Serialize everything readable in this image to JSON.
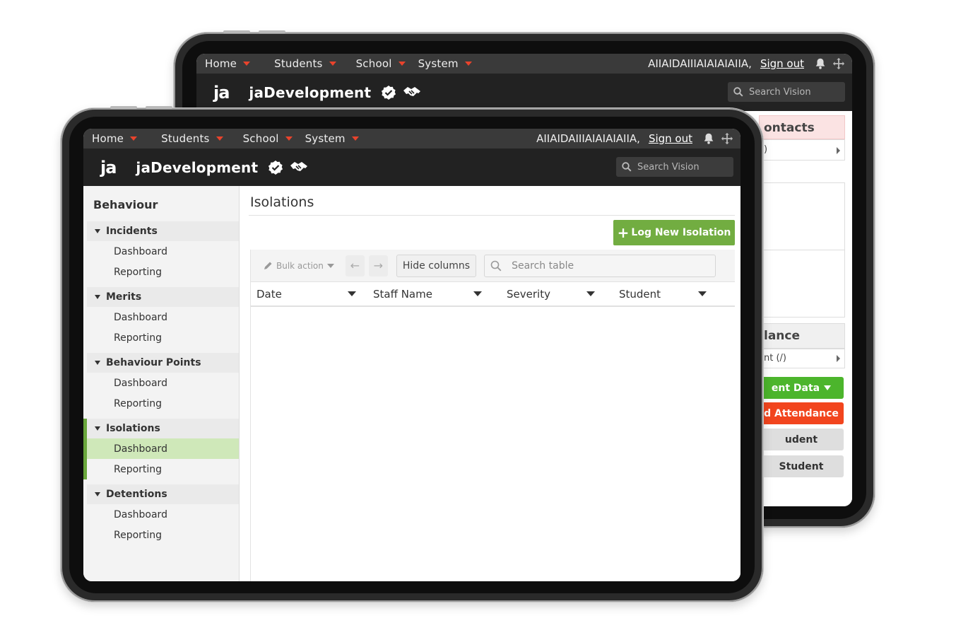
{
  "nav": {
    "items": [
      "Home",
      "Students",
      "School",
      "System"
    ],
    "user": "AIIAIDAIIIAIAIAIAIIA,",
    "sign_out": "Sign out"
  },
  "brand": {
    "logo": "ja",
    "name": "jaDevelopment"
  },
  "global_search": {
    "placeholder": "Search Vision"
  },
  "back_panel": {
    "contacts_heading": "ontacts",
    "contacts_row": ")",
    "attendance_heading": "lance",
    "attendance_row": "nt (/)",
    "student_data_btn": "ent Data",
    "attendance_btn": "d Attendance",
    "student_btn_1": "udent",
    "student_btn_2": "Student"
  },
  "sidebar": {
    "title": "Behaviour",
    "groups": [
      {
        "label": "Incidents",
        "items": [
          "Dashboard",
          "Reporting"
        ]
      },
      {
        "label": "Merits",
        "items": [
          "Dashboard",
          "Reporting"
        ]
      },
      {
        "label": "Behaviour Points",
        "items": [
          "Dashboard",
          "Reporting"
        ]
      },
      {
        "label": "Isolations",
        "items": [
          "Dashboard",
          "Reporting"
        ]
      },
      {
        "label": "Detentions",
        "items": [
          "Dashboard",
          "Reporting"
        ]
      }
    ]
  },
  "main": {
    "title": "Isolations",
    "log_button": "Log New Isolation",
    "bulk_action": "Bulk action",
    "hide_columns": "Hide columns",
    "search_placeholder": "Search table",
    "columns": [
      "Date",
      "Staff Name",
      "Severity",
      "Student"
    ]
  },
  "colors": {
    "accent_green": "#72ad41",
    "active_row": "#cfe8b9",
    "nav_caret": "#e9432c",
    "btn_green": "#4cb52c",
    "btn_red": "#f2451e"
  }
}
